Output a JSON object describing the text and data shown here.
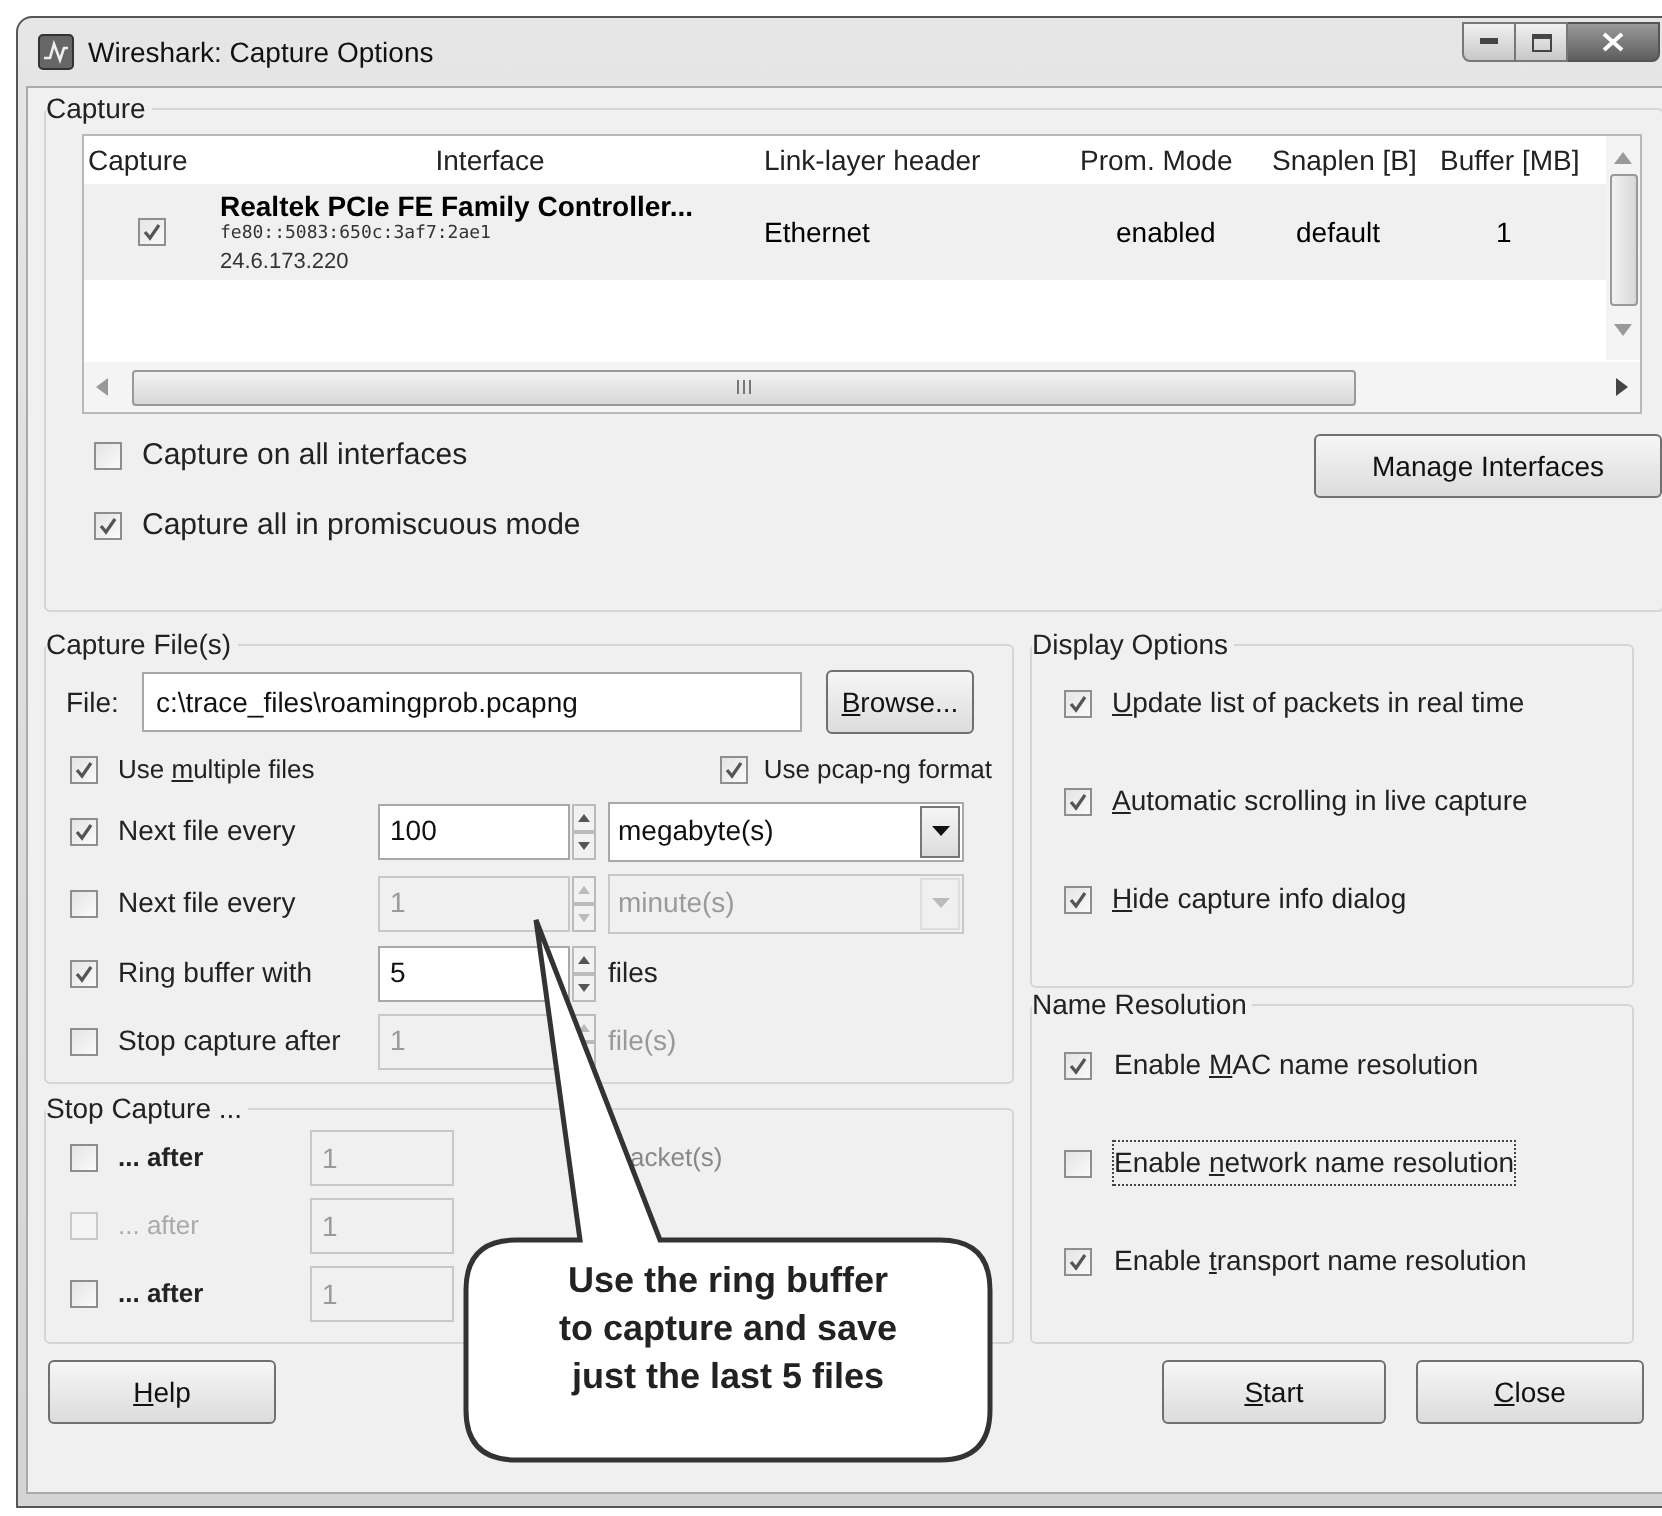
{
  "window": {
    "title": "Wireshark: Capture Options"
  },
  "capture": {
    "title": "Capture",
    "columns": [
      "Capture",
      "Interface",
      "Link-layer header",
      "Prom. Mode",
      "Snaplen [B]",
      "Buffer [MB]"
    ],
    "rows": [
      {
        "checked": true,
        "name": "Realtek PCIe FE Family Controller...",
        "address": "fe80::5083:650c:3af7:2ae1",
        "ip": "24.6.173.220",
        "link_layer": "Ethernet",
        "prom_mode": "enabled",
        "snaplen": "default",
        "buffer": "1"
      }
    ],
    "options": [
      {
        "checked": false,
        "label": "Capture on all interfaces"
      },
      {
        "checked": true,
        "label": "Capture all in promiscuous mode"
      }
    ],
    "manage_button": "Manage Interfaces"
  },
  "capture_files": {
    "title": "Capture File(s)",
    "file_label": "File:",
    "file_value": "c:\\trace_files\\roamingprob.pcapng",
    "browse_button": {
      "mnemonic": "B",
      "rest": "rowse..."
    },
    "multiple": {
      "checked": true,
      "label_parts": {
        "prefix": "Use ",
        "mnemonic": "m",
        "rest": "ultiple files"
      }
    },
    "pcapng": {
      "checked": true,
      "label": "Use pcap-ng format"
    },
    "rows": [
      {
        "kind": "combo",
        "checked": true,
        "disabled": false,
        "label": "Next file every",
        "value": "100",
        "unit": "megabyte(s)"
      },
      {
        "kind": "combo",
        "checked": false,
        "disabled": true,
        "label": "Next file every",
        "value": "1",
        "unit": "minute(s)"
      },
      {
        "kind": "unit",
        "checked": true,
        "disabled": false,
        "label": "Ring buffer with",
        "value": "5",
        "unit": "files"
      },
      {
        "kind": "unit",
        "checked": false,
        "disabled": true,
        "label": "Stop capture after",
        "value": "1",
        "unit": "file(s)"
      }
    ]
  },
  "stop_capture": {
    "title": "Stop Capture ...",
    "rows": [
      {
        "checked": false,
        "disabled": false,
        "label": "... after",
        "value": "1",
        "unit": "acket(s)"
      },
      {
        "checked": false,
        "disabled": true,
        "label": "... after",
        "value": "1"
      },
      {
        "checked": false,
        "disabled": false,
        "label": "... after",
        "value": "1"
      }
    ]
  },
  "display_options": {
    "title": "Display Options",
    "items": [
      {
        "checked": true,
        "label_parts": {
          "mnemonic": "U",
          "rest": "pdate list of packets in real time"
        }
      },
      {
        "checked": true,
        "label_parts": {
          "mnemonic": "A",
          "rest": "utomatic scrolling in live capture"
        }
      },
      {
        "checked": true,
        "label_parts": {
          "mnemonic": "H",
          "rest": "ide capture info dialog"
        }
      }
    ]
  },
  "name_resolution": {
    "title": "Name Resolution",
    "items": [
      {
        "checked": true,
        "focused": false,
        "label_parts": {
          "prefix": "Enable ",
          "mnemonic": "M",
          "rest": "AC name resolution"
        }
      },
      {
        "checked": false,
        "focused": true,
        "label_parts": {
          "prefix": "Enable ",
          "mnemonic": "n",
          "rest": "etwork name resolution"
        }
      },
      {
        "checked": true,
        "focused": false,
        "label_parts": {
          "prefix": "Enable ",
          "mnemonic": "t",
          "rest": "ransport name resolution"
        }
      }
    ]
  },
  "buttons": {
    "help": {
      "mnemonic": "H",
      "rest": "elp"
    },
    "start": {
      "mnemonic": "S",
      "rest": "tart"
    },
    "close": {
      "mnemonic": "C",
      "rest": "lose"
    }
  },
  "callout": {
    "lines": [
      "Use the ring buffer",
      "to capture and save",
      "just the last 5 files"
    ]
  }
}
